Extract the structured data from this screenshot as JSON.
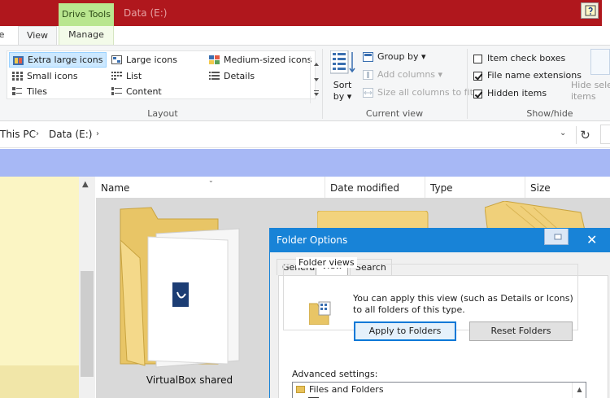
{
  "titlebar": {
    "context_tab": "Drive Tools",
    "window_title": "Data (E:)",
    "accent_color": "#b0171d",
    "context_color": "#b9e68f"
  },
  "ribbon_tabs": {
    "view": "View",
    "manage": "Manage"
  },
  "layout": {
    "group_label": "Layout",
    "items": [
      {
        "label": "Extra large icons",
        "selected": true
      },
      {
        "label": "Large icons",
        "selected": false
      },
      {
        "label": "Medium-sized icons",
        "selected": false
      },
      {
        "label": "Small icons",
        "selected": false
      },
      {
        "label": "List",
        "selected": false
      },
      {
        "label": "Details",
        "selected": false
      },
      {
        "label": "Tiles",
        "selected": false
      },
      {
        "label": "Content",
        "selected": false
      }
    ]
  },
  "current_view": {
    "group_label": "Current view",
    "sort_by": "Sort by",
    "sort_line1": "Sort",
    "sort_line2": "by",
    "group_by": "Group by",
    "add_columns": "Add columns",
    "size_columns": "Size all columns to fit"
  },
  "show_hide": {
    "group_label": "Show/hide",
    "item_check_boxes": {
      "label": "Item check boxes",
      "checked": false
    },
    "file_name_extensions": {
      "label": "File name extensions",
      "checked": true
    },
    "hidden_items": {
      "label": "Hidden items",
      "checked": true
    },
    "hide_selected_line1": "Hide sele",
    "hide_selected_line2": "items"
  },
  "address": {
    "crumbs": [
      "This PC",
      "Data (E:)"
    ]
  },
  "columns": [
    "Name",
    "Date modified",
    "Type",
    "Size"
  ],
  "files": [
    {
      "name": "VirtualBox shared",
      "icon": "folder-icon"
    }
  ],
  "dialog": {
    "title": "Folder Options",
    "tabs": [
      "General",
      "View",
      "Search"
    ],
    "active_tab": "View",
    "folder_views_legend": "Folder views",
    "folder_views_text": "You can apply this view (such as Details or Icons) to all folders of this type.",
    "apply_button": "Apply to Folders",
    "reset_button": "Reset Folders",
    "advanced_label": "Advanced settings:",
    "advanced_items": [
      "Files and Folders"
    ]
  }
}
